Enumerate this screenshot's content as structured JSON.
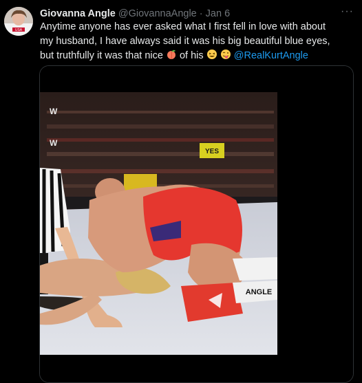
{
  "tweet": {
    "author_name": "Giovanna Angle",
    "handle": "@GiovannaAngle",
    "separator": "·",
    "date": "Jan 6",
    "more_label": "···",
    "text_part1": "Anytime anyone has ever asked what I first fell in love with about my husband, I have always said it was his big beautiful blue eyes, but truthfully it was that nice",
    "text_part2": "of his",
    "mention": "@RealKurtAngle",
    "emoji_1": "peach-emoji",
    "emoji_2": "grinning-squint-emoji",
    "emoji_3": "tongue-out-emoji"
  },
  "media": {
    "arena_sign": "YES",
    "trunks_text": "ANGLE",
    "broadcast_logo": "W"
  }
}
